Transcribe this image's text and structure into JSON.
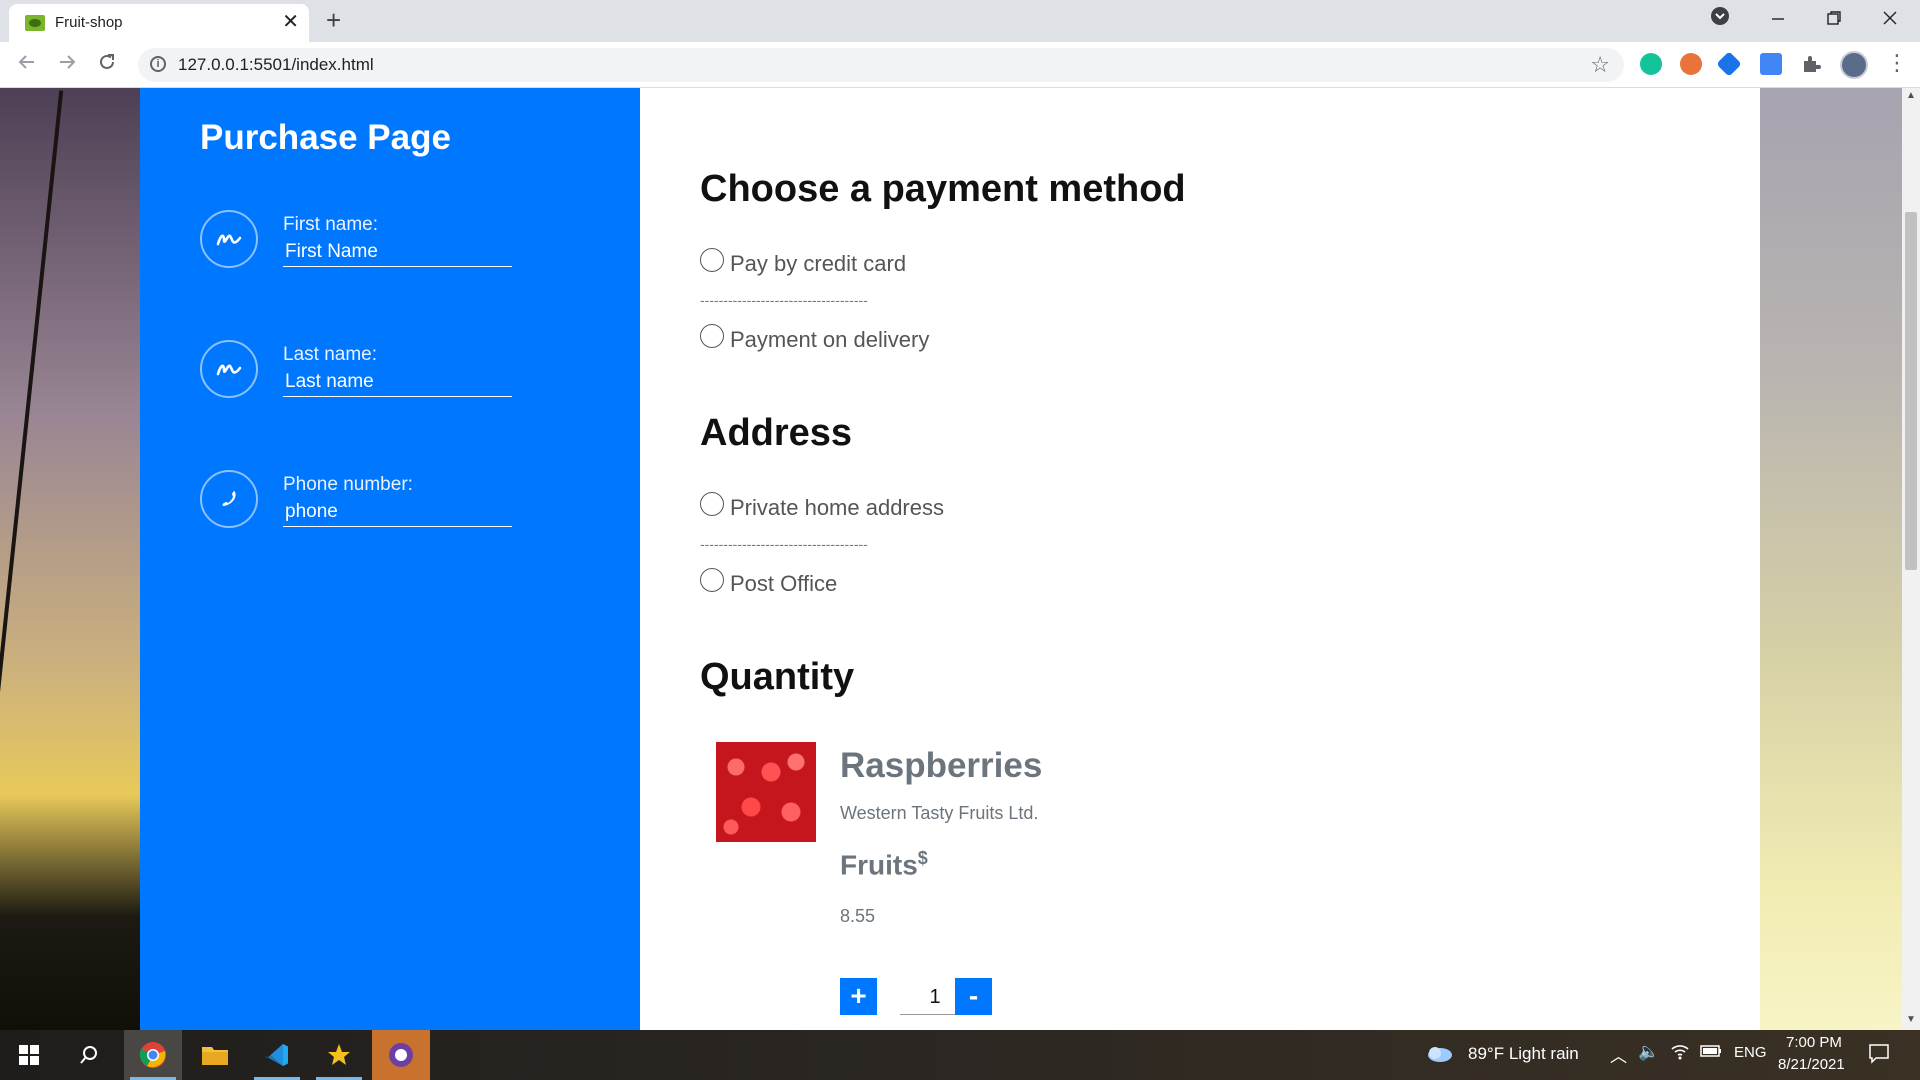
{
  "browser": {
    "tab_title": "Fruit-shop",
    "tab_close": "✕",
    "new_tab": "+",
    "url": "127.0.0.1:5501/index.html"
  },
  "sidebar": {
    "title": "Purchase Page",
    "fields": [
      {
        "label": "First name:",
        "placeholder": "First Name",
        "icon": "signature-icon"
      },
      {
        "label": "Last name:",
        "placeholder": "Last name",
        "icon": "signature-icon"
      },
      {
        "label": "Phone number:",
        "placeholder": "phone",
        "icon": "phone-icon"
      }
    ],
    "accent_color": "#0077ff"
  },
  "payment": {
    "heading": "Choose a payment method",
    "options": [
      "Pay by credit card",
      "Payment on delivery"
    ],
    "separator": "------------------------------------"
  },
  "address": {
    "heading": "Address",
    "options": [
      "Private home address",
      "Post Office"
    ],
    "separator": "------------------------------------"
  },
  "quantity": {
    "heading": "Quantity",
    "product": {
      "name": "Raspberries",
      "company": "Western Tasty Fruits Ltd.",
      "category": "Fruits",
      "currency": "$",
      "price": "8.55"
    },
    "plus": "+",
    "minus": "-",
    "value": "1"
  },
  "taskbar": {
    "weather": "89°F  Light rain",
    "language": "ENG",
    "time": "7:00 PM",
    "date": "8/21/2021"
  }
}
